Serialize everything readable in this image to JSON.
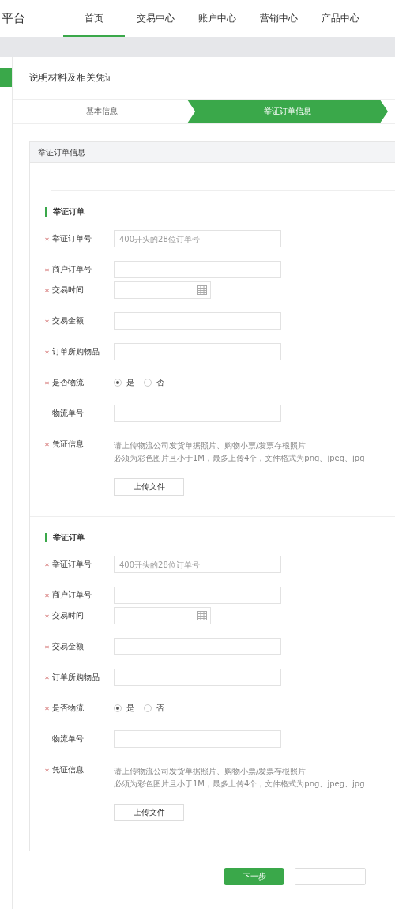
{
  "brand": "平台",
  "nav": [
    {
      "label": "首页",
      "selected": true
    },
    {
      "label": "交易中心",
      "selected": false
    },
    {
      "label": "账户中心",
      "selected": false
    },
    {
      "label": "营销中心",
      "selected": false
    },
    {
      "label": "产品中心",
      "selected": false
    }
  ],
  "page_title": "说明材料及相关凭证",
  "steps": [
    {
      "label": "基本信息",
      "selected": false
    },
    {
      "label": "举证订单信息",
      "selected": true
    }
  ],
  "panel": {
    "title": "举证订单信息",
    "sections": [
      {
        "title": "举证订单",
        "fields": [
          {
            "kind": "text",
            "label": "举证订单号",
            "required": true,
            "placeholder": "400开头的28位订单号"
          },
          {
            "kind": "text",
            "label": "商户订单号",
            "required": true
          },
          {
            "kind": "date",
            "label": "交易时间",
            "required": true
          },
          {
            "kind": "text",
            "label": "交易金额",
            "required": true
          },
          {
            "kind": "text",
            "label": "订单所购物品",
            "required": true
          },
          {
            "kind": "radio",
            "label": "是否物流",
            "required": true,
            "options": [
              {
                "label": "是",
                "selected": true
              },
              {
                "label": "否",
                "selected": false
              }
            ]
          },
          {
            "kind": "text",
            "label": "物流单号",
            "required": false
          },
          {
            "kind": "upload",
            "label": "凭证信息",
            "required": true,
            "hints": [
              "请上传物流公司发货单据照片、购物小票/发票存根照片",
              "必须为彩色图片且小于1M，最多上传4个，文件格式为png、jpeg、jpg"
            ],
            "button": "上传文件"
          }
        ]
      },
      {
        "title": "举证订单",
        "fields": [
          {
            "kind": "text",
            "label": "举证订单号",
            "required": true,
            "placeholder": "400开头的28位订单号"
          },
          {
            "kind": "text",
            "label": "商户订单号",
            "required": true
          },
          {
            "kind": "date",
            "label": "交易时间",
            "required": true
          },
          {
            "kind": "text",
            "label": "交易金额",
            "required": true
          },
          {
            "kind": "text",
            "label": "订单所购物品",
            "required": true
          },
          {
            "kind": "radio",
            "label": "是否物流",
            "required": true,
            "options": [
              {
                "label": "是",
                "selected": true
              },
              {
                "label": "否",
                "selected": false
              }
            ]
          },
          {
            "kind": "text",
            "label": "物流单号",
            "required": false
          },
          {
            "kind": "upload",
            "label": "凭证信息",
            "required": true,
            "hints": [
              "请上传物流公司发货单据照片、购物小票/发票存根照片",
              "必须为彩色图片且小于1M，最多上传4个，文件格式为png、jpeg、jpg"
            ],
            "button": "上传文件"
          }
        ]
      }
    ]
  },
  "next_button": "下一步"
}
